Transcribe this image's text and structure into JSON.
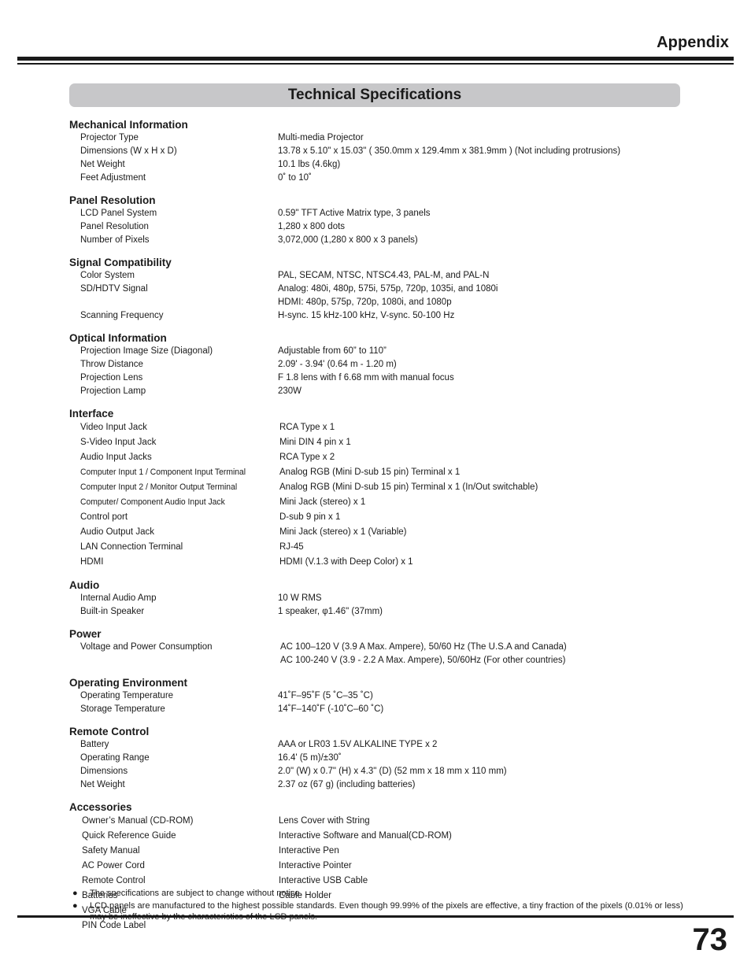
{
  "header": {
    "title": "Appendix"
  },
  "banner": {
    "title": "Technical Specifications"
  },
  "footer": {
    "page_number": "73"
  },
  "sections": [
    {
      "heading": "Mechanical Information",
      "rows": [
        {
          "label": "Projector Type",
          "value": "Multi-media Projector"
        },
        {
          "label": "Dimensions (W x H x D)",
          "value": "13.78 x  5.10\"  x  15.03\" ( 350.0mm x 129.4mm x 381.9mm ) (Not including protrusions)"
        },
        {
          "label": "Net Weight",
          "value": "10.1 lbs (4.6kg)"
        },
        {
          "label": "Feet Adjustment",
          "value": "0˚ to 10˚"
        }
      ]
    },
    {
      "heading": "Panel Resolution",
      "rows": [
        {
          "label": "LCD Panel System",
          "value": "0.59\" TFT Active Matrix type, 3 panels"
        },
        {
          "label": "Panel Resolution",
          "value": "1,280 x 800 dots"
        },
        {
          "label": "Number of Pixels",
          "value": "3,072,000 (1,280 x 800 x 3 panels)"
        }
      ]
    },
    {
      "heading": "Signal Compatibility",
      "rows": [
        {
          "label": "Color System",
          "value": "PAL, SECAM, NTSC, NTSC4.43, PAL-M, and PAL-N"
        },
        {
          "label": "SD/HDTV Signal",
          "value": "Analog: 480i, 480p, 575i, 575p, 720p, 1035i, and 1080i"
        },
        {
          "label": "",
          "value": "HDMI: 480p, 575p, 720p, 1080i, and 1080p"
        },
        {
          "label": "Scanning Frequency",
          "value": "H-sync. 15 kHz-100 kHz, V-sync. 50-100 Hz"
        }
      ]
    },
    {
      "heading": "Optical Information",
      "rows": [
        {
          "label": "Projection Image Size (Diagonal)",
          "value": "Adjustable from 60” to 110”"
        },
        {
          "label": "Throw Distance",
          "value": "2.09' - 3.94' (0.64 m - 1.20 m)"
        },
        {
          "label": "Projection Lens",
          "value": "F 1.8 lens with f 6.68 mm with manual focus"
        },
        {
          "label": "Projection Lamp",
          "value": "230W"
        }
      ]
    },
    {
      "heading": "Interface",
      "rows": [
        {
          "label": "Video Input Jack",
          "value": " RCA Type x 1"
        },
        {
          "label": "S-Video Input Jack",
          "value": "Mini DIN 4 pin x 1"
        },
        {
          "label": "Audio Input Jacks",
          "value": " RCA Type x 2"
        },
        {
          "label": "Computer Input 1 / Component Input Terminal",
          "value": "Analog RGB (Mini D-sub 15 pin) Terminal x 1"
        },
        {
          "label": "Computer Input 2 / Monitor Output Terminal",
          "value": " Analog RGB (Mini D-sub 15 pin) Terminal x 1 (In/Out switchable)"
        },
        {
          "label": "Computer/ Component Audio Input Jack",
          "value": "Mini Jack (stereo) x 1"
        },
        {
          "label": "Control port",
          "value": "D-sub 9 pin x 1"
        },
        {
          "label": "Audio Output Jack",
          "value": "Mini Jack (stereo) x 1 (Variable)"
        },
        {
          "label": "LAN Connection Terminal",
          "value": "RJ-45"
        },
        {
          "label": "HDMI",
          "value": "HDMI (V.1.3 with Deep Color) x 1"
        }
      ]
    },
    {
      "heading": "Audio",
      "rows": [
        {
          "label": "Internal Audio Amp",
          "value": "10 W RMS"
        },
        {
          "label": "Built-in Speaker",
          "value": "1 speaker, φ1.46\" (37mm)"
        }
      ]
    },
    {
      "heading": "Power",
      "rows": [
        {
          "label": "Voltage and Power Consumption",
          "value": " AC 100–120 V (3.9 A Max. Ampere), 50/60 Hz (The U.S.A and Canada)"
        },
        {
          "label": "",
          "value": " AC 100-240 V (3.9 - 2.2 A Max. Ampere), 50/60Hz (For other countries)"
        }
      ]
    },
    {
      "heading": "Operating Environment",
      "rows": [
        {
          "label": "Operating Temperature",
          "value": "41˚F–95˚F (5 ˚C–35 ˚C)"
        },
        {
          "label": "Storage Temperature",
          "value": "14˚F–140˚F (-10˚C–60 ˚C)"
        }
      ]
    },
    {
      "heading": "Remote Control",
      "rows": [
        {
          "label": "Battery",
          "value": "AAA or LR03 1.5V ALKALINE  TYPE x 2"
        },
        {
          "label": "Operating Range",
          "value": "16.4' (5 m)/±30˚"
        },
        {
          "label": "Dimensions",
          "value": "2.0\" (W) x 0.7\" (H) x 4.3\" (D) (52 mm x 18 mm x 110 mm)"
        },
        {
          "label": "Net Weight",
          "value": "2.37 oz (67 g) (including batteries)"
        }
      ]
    }
  ],
  "accessories": {
    "heading": "Accessories",
    "rows": [
      {
        "col1": "Owner’s Manual (CD-ROM)",
        "col2": "Lens Cover with String"
      },
      {
        "col1": "Quick Reference Guide",
        "col2": " Interactive Software and Manual(CD-ROM)"
      },
      {
        "col1": "Safety Manual",
        "col2": "Interactive Pen"
      },
      {
        "col1": "AC Power Cord",
        "col2": "Interactive Pointer"
      },
      {
        "col1": "Remote Control",
        "col2": "Interactive USB Cable"
      },
      {
        "col1": "Batteries",
        "col2": "Cable Holder"
      },
      {
        "col1": "VGA Cable",
        "col2": ""
      },
      {
        "col1": "PIN Code Label",
        "col2": ""
      }
    ]
  },
  "footnotes": [
    {
      "bullet": "●",
      "text": "The specifications are subject to change without notice."
    },
    {
      "bullet": "●",
      "text": "LCD panels are manufactured to the highest possible standards. Even though 99.99% of the pixels are effective, a tiny fraction of the pixels (0.01% or less) may be ineffective by the characteristics of the LCD panels."
    }
  ]
}
